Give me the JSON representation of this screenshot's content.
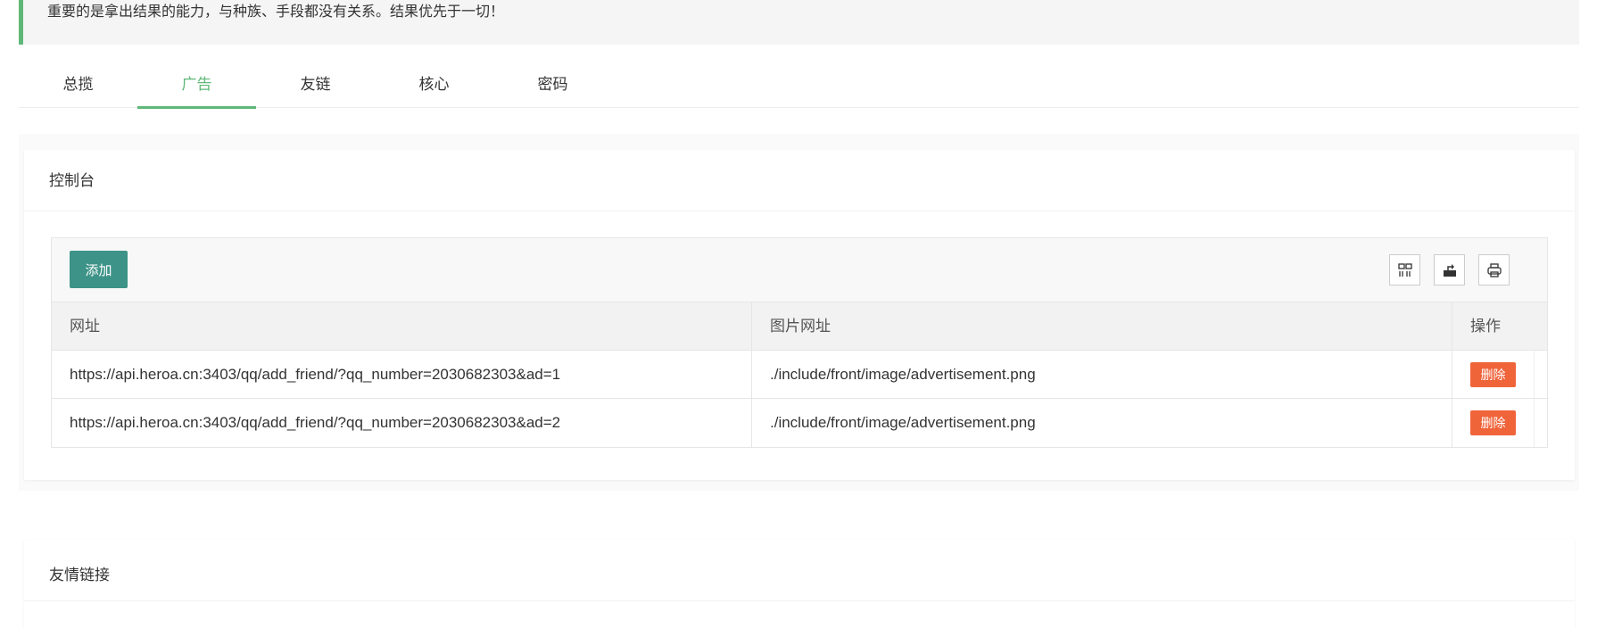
{
  "notice": "重要的是拿出结果的能力，与种族、手段都没有关系。结果优先于一切！",
  "tabs": [
    {
      "label": "总揽"
    },
    {
      "label": "广告"
    },
    {
      "label": "友链"
    },
    {
      "label": "核心"
    },
    {
      "label": "密码"
    }
  ],
  "active_tab": "广告",
  "console": {
    "title": "控制台",
    "add_label": "添加",
    "toolbar_icons": [
      "columns-icon",
      "export-icon",
      "print-icon"
    ],
    "columns": [
      "网址",
      "图片网址",
      "操作"
    ],
    "rows": [
      {
        "url": "https://api.heroa.cn:3403/qq/add_friend/?qq_number=2030682303&ad=1",
        "image": "./include/front/image/advertisement.png",
        "action": "删除"
      },
      {
        "url": "https://api.heroa.cn:3403/qq/add_friend/?qq_number=2030682303&ad=2",
        "image": "./include/front/image/advertisement.png",
        "action": "删除"
      }
    ]
  },
  "friends": {
    "title": "友情链接"
  },
  "colors": {
    "accent": "#5FB878",
    "primary_button": "#3d9387",
    "danger": "#F0643A"
  }
}
